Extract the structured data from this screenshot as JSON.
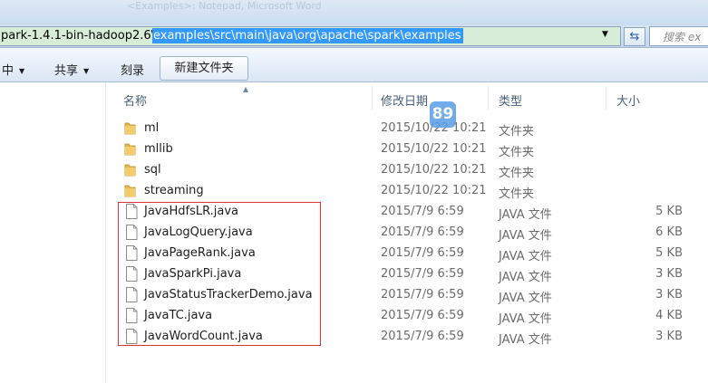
{
  "window": {
    "title_ghost": "<Examples>: Notepad, Microsoft Word"
  },
  "address": {
    "prefix": "park-1.4.1-bin-hadoop2.6\\",
    "selected": "examples\\src\\main\\java\\org\\apache\\spark\\examples",
    "dropdown_icon": "chevron-down-icon",
    "refresh_icon": "refresh-icon",
    "search_placeholder": "搜索 ex"
  },
  "toolbar": {
    "items": [
      {
        "label": "中",
        "has_arrow": true
      },
      {
        "label": "共享",
        "has_arrow": true
      },
      {
        "label": "刻录",
        "has_arrow": false
      }
    ],
    "new_folder": "新建文件夹"
  },
  "columns": {
    "name": "名称",
    "date": "修改日期",
    "type": "类型",
    "size": "大小"
  },
  "badge": "89",
  "colors": {
    "selection": "#3399ff",
    "highlight_box": "#e0313b",
    "folder": "#e8b94a"
  },
  "files": [
    {
      "name": "ml",
      "date": "2015/10/22 10:21",
      "type": "文件夹",
      "size": "",
      "kind": "folder"
    },
    {
      "name": "mllib",
      "date": "2015/10/22 10:21",
      "type": "文件夹",
      "size": "",
      "kind": "folder"
    },
    {
      "name": "sql",
      "date": "2015/10/22 10:21",
      "type": "文件夹",
      "size": "",
      "kind": "folder"
    },
    {
      "name": "streaming",
      "date": "2015/10/22 10:21",
      "type": "文件夹",
      "size": "",
      "kind": "folder"
    },
    {
      "name": "JavaHdfsLR.java",
      "date": "2015/7/9 6:59",
      "type": "JAVA 文件",
      "size": "5 KB",
      "kind": "file"
    },
    {
      "name": "JavaLogQuery.java",
      "date": "2015/7/9 6:59",
      "type": "JAVA 文件",
      "size": "6 KB",
      "kind": "file"
    },
    {
      "name": "JavaPageRank.java",
      "date": "2015/7/9 6:59",
      "type": "JAVA 文件",
      "size": "5 KB",
      "kind": "file"
    },
    {
      "name": "JavaSparkPi.java",
      "date": "2015/7/9 6:59",
      "type": "JAVA 文件",
      "size": "3 KB",
      "kind": "file"
    },
    {
      "name": "JavaStatusTrackerDemo.java",
      "date": "2015/7/9 6:59",
      "type": "JAVA 文件",
      "size": "3 KB",
      "kind": "file"
    },
    {
      "name": "JavaTC.java",
      "date": "2015/7/9 6:59",
      "type": "JAVA 文件",
      "size": "4 KB",
      "kind": "file"
    },
    {
      "name": "JavaWordCount.java",
      "date": "2015/7/9 6:59",
      "type": "JAVA 文件",
      "size": "3 KB",
      "kind": "file"
    }
  ]
}
